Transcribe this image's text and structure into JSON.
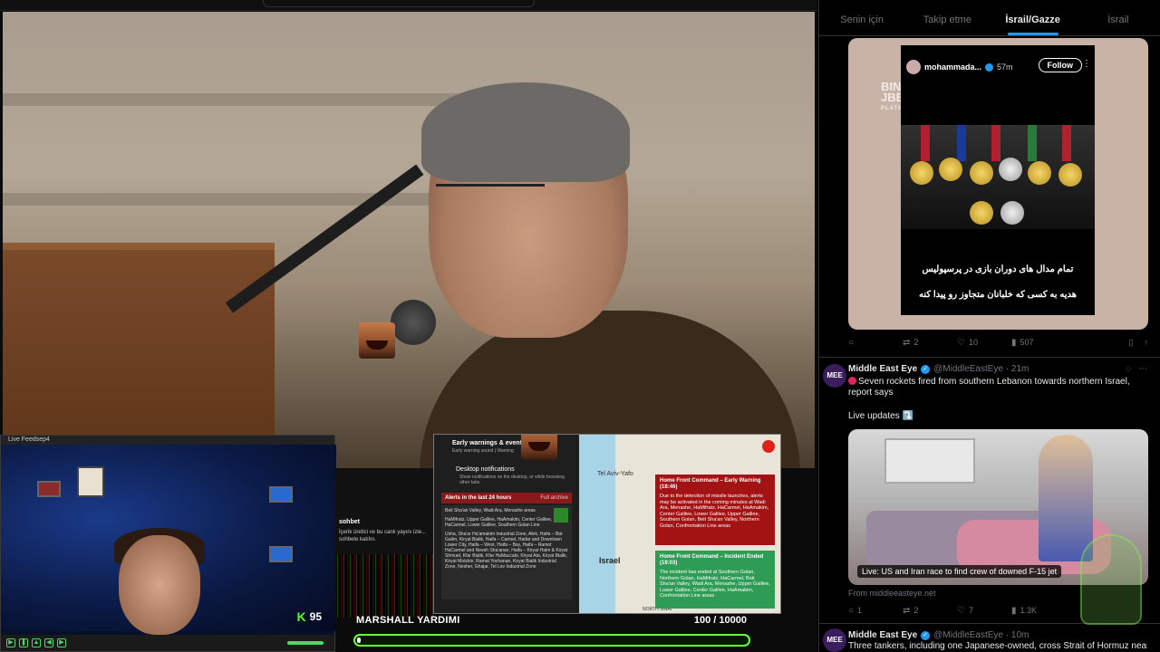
{
  "video": {
    "chat": {
      "title": "sohbet",
      "body": "İçerik üretici ve bu canlı yayını izle... sohbete katılın."
    },
    "webcam": {
      "window_title": "Live Feedsep4",
      "viewer_count": "95"
    },
    "alerts": {
      "early_warnings_title": "Early warnings & event",
      "early_warning_sound": "Early warning sound",
      "warning_tab": "Warning",
      "desktop_notifications": "Desktop notifications",
      "desktop_sub": "Show notifications on the desktop, or while browsing other tabs",
      "alerts_24h": "Alerts in the last 24 hours",
      "full_archive": "Full archive",
      "item1": "Beit Sha'an Valley, Wadi Ara, Menashe areas",
      "item2": "HaMifratz, Upper Galilee, HaAmakim, Center Galilee, HaCarmel, Lower Galilee, Southern Golan Line",
      "item3": "Usha, Sha'ar Ha'amakim Industrial Zone, Afek, Haifa – Bat Galim, Kiryat Bialik, Haifa – Carmel, Hadar and Downtown Lower City, Haifa – West, Haifa – Bay, Haifa – Ramot HaCarmel and Neveh Sha'anan, Haifa – Kiryat Haim & Kiryat Shmuel, Kfar Bialik, Kfar HaMaccabi, Kiryat Ata, Kiryat Bialik, Kiryat Motzkin, Ramat Yochanan, Kiryat Bialik Industrial Zone, Nesher, Ghajar, Tel Lev Industrial Zone",
      "map_label_aviv": "Tel Aviv-Yafo",
      "map_label_israel": "Israel",
      "map_label_sinai": "NORTH SINAI",
      "red_title": "Home Front Command – Early Warning (18:46)",
      "red_body": "Due to the detection of missile launches, alerts may be activated in the coming minutes at Wadi Ara, Menashe, HaMifratz, HaCarmel, HaAmakim, Center Galilee, Lower Galilee, Upper Galilee, Southern Golan, Beit Sha'an Valley, Northern Golan, Confrontation Line areas",
      "green_title": "Home Front Command – Incident Ended (19:03)",
      "green_body": "The incident has ended at Southern Golan, Northern Golan, HaMifratz, HaCarmel, Beit Sha'an Valley, Wadi Ara, Menashe, Upper Galilee, Lower Galilee, Center Galilee, HaAmakim, Confrontation Line areas"
    },
    "donation": {
      "label": "MARSHALL YARDIMI",
      "count": "100 / 10000",
      "progress": 0.01
    }
  },
  "feed": {
    "tabs": [
      {
        "label": "Senin için"
      },
      {
        "label": "Takip etme"
      },
      {
        "label": "İsrail/Gazze"
      },
      {
        "label": "İsrail"
      }
    ],
    "post1": {
      "story_user": "mohammada...",
      "story_time": "57m",
      "follow_label": "Follow",
      "watermark": "BINT JBEIL",
      "watermark_sub": "PLATFORMS",
      "fa_line1": "تمام مدال های دوران بازی در پرسپولیس",
      "fa_line2": "هدیه به کسی که خلبانان متجاوز رو پیدا کنه",
      "replies": "",
      "reposts": "2",
      "likes": "10",
      "views": "507"
    },
    "post2": {
      "name": "Middle East Eye",
      "handle": "@MiddleEastEye · 21m",
      "text": "Seven rockets fired from southern Lebanon towards northern Israel, report says",
      "subtext": "Live updates ⤵️",
      "media_caption": "Live: US and Iran race to find crew of downed F-15 jet",
      "source": "From middleeasteye.net",
      "replies": "1",
      "reposts": "2",
      "likes": "7",
      "views": "1.3K"
    },
    "post3": {
      "name": "Middle East Eye",
      "handle": "@MiddleEastEye · 10m",
      "text": "Three tankers, including one Japanese-owned, cross Strait of Hormuz near"
    }
  }
}
